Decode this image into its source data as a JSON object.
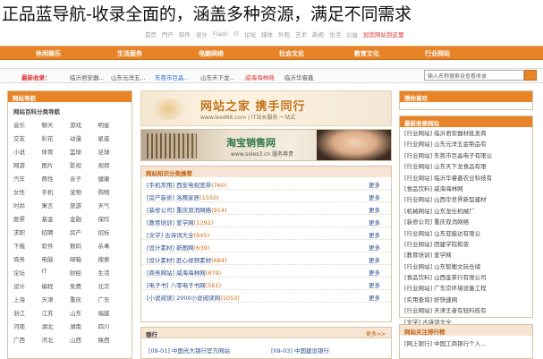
{
  "caption": "正品蓝导航-收录全面的，涵盖多种资源，满足不同需求",
  "top_links": [
    "首页",
    "門户",
    "软件",
    "设计",
    "Flash",
    "IT",
    "论坛",
    "媒体",
    "外观",
    "艺术",
    "新闻",
    "生活",
    "公益",
    "加您网站到这里"
  ],
  "nav": [
    "休闲娱乐",
    "生活服务",
    "电脑网络",
    "社会文化",
    "教育文化",
    "行业网站"
  ],
  "news": {
    "label": "最新收录：",
    "items": [
      {
        "text": "临沂君安器...",
        "color": "normal"
      },
      {
        "text": "山东元洋五...",
        "color": "normal"
      },
      {
        "text": "东莞市巨晶...",
        "color": "blue"
      },
      {
        "text": "山东天下龙...",
        "color": "normal"
      },
      {
        "text": "威海海林网",
        "color": "red"
      },
      {
        "text": "临沂华睿鑫",
        "color": "normal"
      }
    ]
  },
  "search": {
    "placeholder": "输入名称搜索自查看收录"
  },
  "left": {
    "head": "网站导航",
    "sub": "网站百科分类导航",
    "cats": [
      "音乐",
      "聊天",
      "游戏",
      "明星",
      "交友",
      "彩花",
      "动漫",
      "星座",
      "小说",
      "体育",
      "篮球",
      "足球",
      "网游",
      "图片",
      "影视",
      "视频",
      "汽车",
      "两性",
      "亲子",
      "健康",
      "女性",
      "手机",
      "宠物",
      "购物",
      "时尚",
      "寓言",
      "旅游",
      "天气",
      "股票",
      "基金",
      "金融",
      "保险",
      "求职",
      "招聘",
      "房产",
      "招标",
      "下载",
      "软件",
      "数码",
      "杀毒",
      "商务",
      "电脑",
      "邮箱",
      "搜索",
      "论坛",
      "IT",
      "财经",
      "生活",
      "设计",
      "编程",
      "免费",
      "北京",
      "上海",
      "天津",
      "重庆",
      "广东",
      "浙江",
      "江苏",
      "山东",
      "福建",
      "河南",
      "湖北",
      "湖南",
      "四川",
      "广西",
      "河北",
      "山西",
      "陕西"
    ]
  },
  "banner1": {
    "title": "网站之家 携手同行",
    "url": "www.lexd66.com | IT站长服务  一站式"
  },
  "banner2": {
    "title": "淘宝销售网",
    "url": "www.soles3.cn  服务尊贵"
  },
  "knowledge": {
    "head": "网站知识分类推荐",
    "more": "更多",
    "rows": [
      {
        "text": "[手机常用] 西安电视宽带",
        "num": "(760)"
      },
      {
        "text": "[房产装修] 洛鹰家居",
        "num": "(1550)"
      },
      {
        "text": "[装修公司] 重庆双消网络",
        "num": "(914)"
      },
      {
        "text": "[教育培训] 爱学网",
        "num": "(1292)"
      },
      {
        "text": "[文学] 古诗词大全",
        "num": "(645)"
      },
      {
        "text": "[设计素材] 新图网",
        "num": "(639)"
      },
      {
        "text": "[设计素材] 匠心视频素材",
        "num": "(684)"
      },
      {
        "text": "[商务网站] 威海海林网",
        "num": "(879)"
      },
      {
        "text": "[电子书] 八零电子书网",
        "num": "(561)"
      },
      {
        "text": "[小说阅读] 2000小说阅读网",
        "num": "(1053)"
      }
    ]
  },
  "bank": {
    "head": "银行",
    "more": "更多>>",
    "left": "[09-01] 中国光大银行官方网站",
    "right": "[09-03] 中国建设银行"
  },
  "right": {
    "top_head": "猜你喜欢",
    "list_head": "最新收录网站",
    "rows": [
      "[行业网站] 临沂君安器材批发商",
      "[行业网站] 山东元洋五金制品有",
      "[行业网站] 东莞市巨晶电子有限公",
      "[行业网站] 山东天下龙食品有限",
      "[行业网站] 临沂华睿鑫农业科技有",
      "[食品饮料] 威海海林网",
      "[行业网站] 山西华世界新型建材",
      "[机械网站] 山东龙仕机械厂",
      "[装修公司] 重庆双消网络",
      "[行业网站] 山东亚能达有限公",
      "[行业网站] 团建学院和资",
      "[教育培训] 爱学网",
      "[行业网站] 山东智衡文玩仓储",
      "[食品饮料] 山西金茶行有限公司",
      "[行业网站] 广东京环境设备工程",
      "[实用查询] 好快速网",
      "[行业网站] 天津王者有轻科技有",
      "[文学] 古诗词大全"
    ],
    "bottom_head": "网站关注排行榜",
    "bottom_row": "[网上银行] 中国工商银行个人..."
  }
}
